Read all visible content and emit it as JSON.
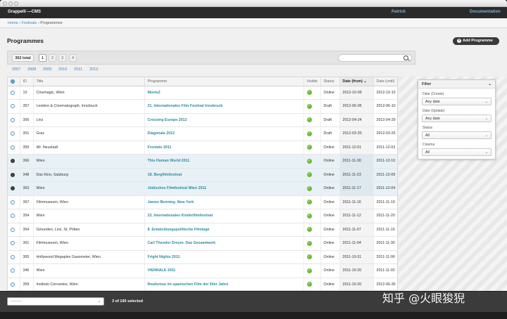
{
  "app": {
    "brand": "Grappelli —CMS",
    "user": "Patrick",
    "docs": "Documentation"
  },
  "breadcrumb": {
    "home": "Home",
    "sep1": "›",
    "festivals": "Festivals",
    "sep2": "›",
    "current": "Programmes"
  },
  "page": {
    "title": "Programmes",
    "add_label": "Add Programme"
  },
  "toolbar": {
    "total": "362 total",
    "pages": [
      "1",
      "2",
      "3",
      "4"
    ],
    "search_placeholder": ""
  },
  "years": [
    "2007",
    "2008",
    "2009",
    "2010",
    "2011",
    "2012"
  ],
  "table": {
    "headers": {
      "id": "ID",
      "title": "Title",
      "programme": "Programme",
      "visible": "Visible",
      "status": "Status",
      "date_from": "Date (from)",
      "date_until": "Date (until)"
    },
    "rows": [
      {
        "id": "10",
        "title": "Cinemagic, Wien",
        "programme": "MovieZ",
        "status": "Online",
        "from": "2012-10-09",
        "until": "2012-10-10",
        "selected": false
      },
      {
        "id": "357",
        "title": "Leokino & Cinematograph, Innsbruck",
        "programme": "21. Internationales Film Festival Innsbruck",
        "status": "Draft",
        "from": "2012-06-05",
        "until": "2012-06-10",
        "selected": false
      },
      {
        "id": "356",
        "title": "Linz",
        "programme": "Crossing Europe 2012",
        "status": "Draft",
        "from": "2012-04-24",
        "until": "2012-04-29",
        "selected": false
      },
      {
        "id": "351",
        "title": "Graz",
        "programme": "Diagonale 2012",
        "status": "Draft",
        "from": "2012-03-20",
        "until": "2012-03-25",
        "selected": false
      },
      {
        "id": "350",
        "title": "Wr. Neustadt",
        "programme": "Frontale 2011",
        "status": "Online",
        "from": "2011-12-01",
        "until": "2011-12-03",
        "selected": false
      },
      {
        "id": "366",
        "title": "Wien",
        "programme": "This Human World 2011",
        "status": "Online",
        "from": "2011-11-30",
        "until": "2011-12-10",
        "selected": true
      },
      {
        "id": "348",
        "title": "Das Kino, Salzburg",
        "programme": "18. Bergfilmfestival",
        "status": "Online",
        "from": "2011-11-23",
        "until": "2011-12-09",
        "selected": true
      },
      {
        "id": "363",
        "title": "Wien",
        "programme": "Jüdisches Filmfestival Wien 2011",
        "status": "Online",
        "from": "2011-11-17",
        "until": "2011-12-04",
        "selected": true
      },
      {
        "id": "367",
        "title": "Filmmuseum, Wien",
        "programme": "James Benning. New York",
        "status": "Online",
        "from": "2011-11-16",
        "until": "2011-11-19",
        "selected": false
      },
      {
        "id": "354",
        "title": "Wien",
        "programme": "23. Internationales Kinderfilmfestival",
        "status": "Online",
        "from": "2011-11-12",
        "until": "2011-11-20",
        "selected": false
      },
      {
        "id": "364",
        "title": "Gmunden, Linz, St. Pölten",
        "programme": "8. Entwicklungspolitische Filmtage",
        "status": "Online",
        "from": "2011-11-07",
        "until": "2011-11-16",
        "selected": false
      },
      {
        "id": "361",
        "title": "Filmmuseum, Wien",
        "programme": "Carl Theodor Dreyer. Das Gesamtwerk",
        "status": "Online",
        "from": "2011-11-04",
        "until": "2011-11-30",
        "selected": false
      },
      {
        "id": "365",
        "title": "Hollywood Megaplex Gasometer, Wien",
        "programme": "Fright Nights 2011",
        "status": "Online",
        "from": "2011-10-31",
        "until": "2011-11-06",
        "selected": false
      },
      {
        "id": "346",
        "title": "Wien",
        "programme": "VIENNALE 2011",
        "status": "Online",
        "from": "2011-10-20",
        "until": "2011-11-02",
        "selected": false
      },
      {
        "id": "359",
        "title": "Instituto Cervantes, Wien",
        "programme": "Realismus im spanischen Film der 50er Jahre",
        "status": "Online",
        "from": "2011-10-20",
        "until": "2012-06-30",
        "selected": false
      }
    ]
  },
  "filter": {
    "title": "Filter",
    "fields": [
      {
        "label": "Date (Create)",
        "value": "Any date"
      },
      {
        "label": "Date (Update)",
        "value": "Any date"
      },
      {
        "label": "Status",
        "value": "All"
      },
      {
        "label": "Cinema",
        "value": "All"
      }
    ]
  },
  "footer": {
    "action_value": "---------",
    "selected_count": "3 of 100 selected"
  },
  "watermark": "知乎 @火眼狻猊",
  "colors": {
    "accent": "#3a86c2",
    "title_link": "#2d8a9e",
    "visible_check": "#6ebc3a"
  }
}
